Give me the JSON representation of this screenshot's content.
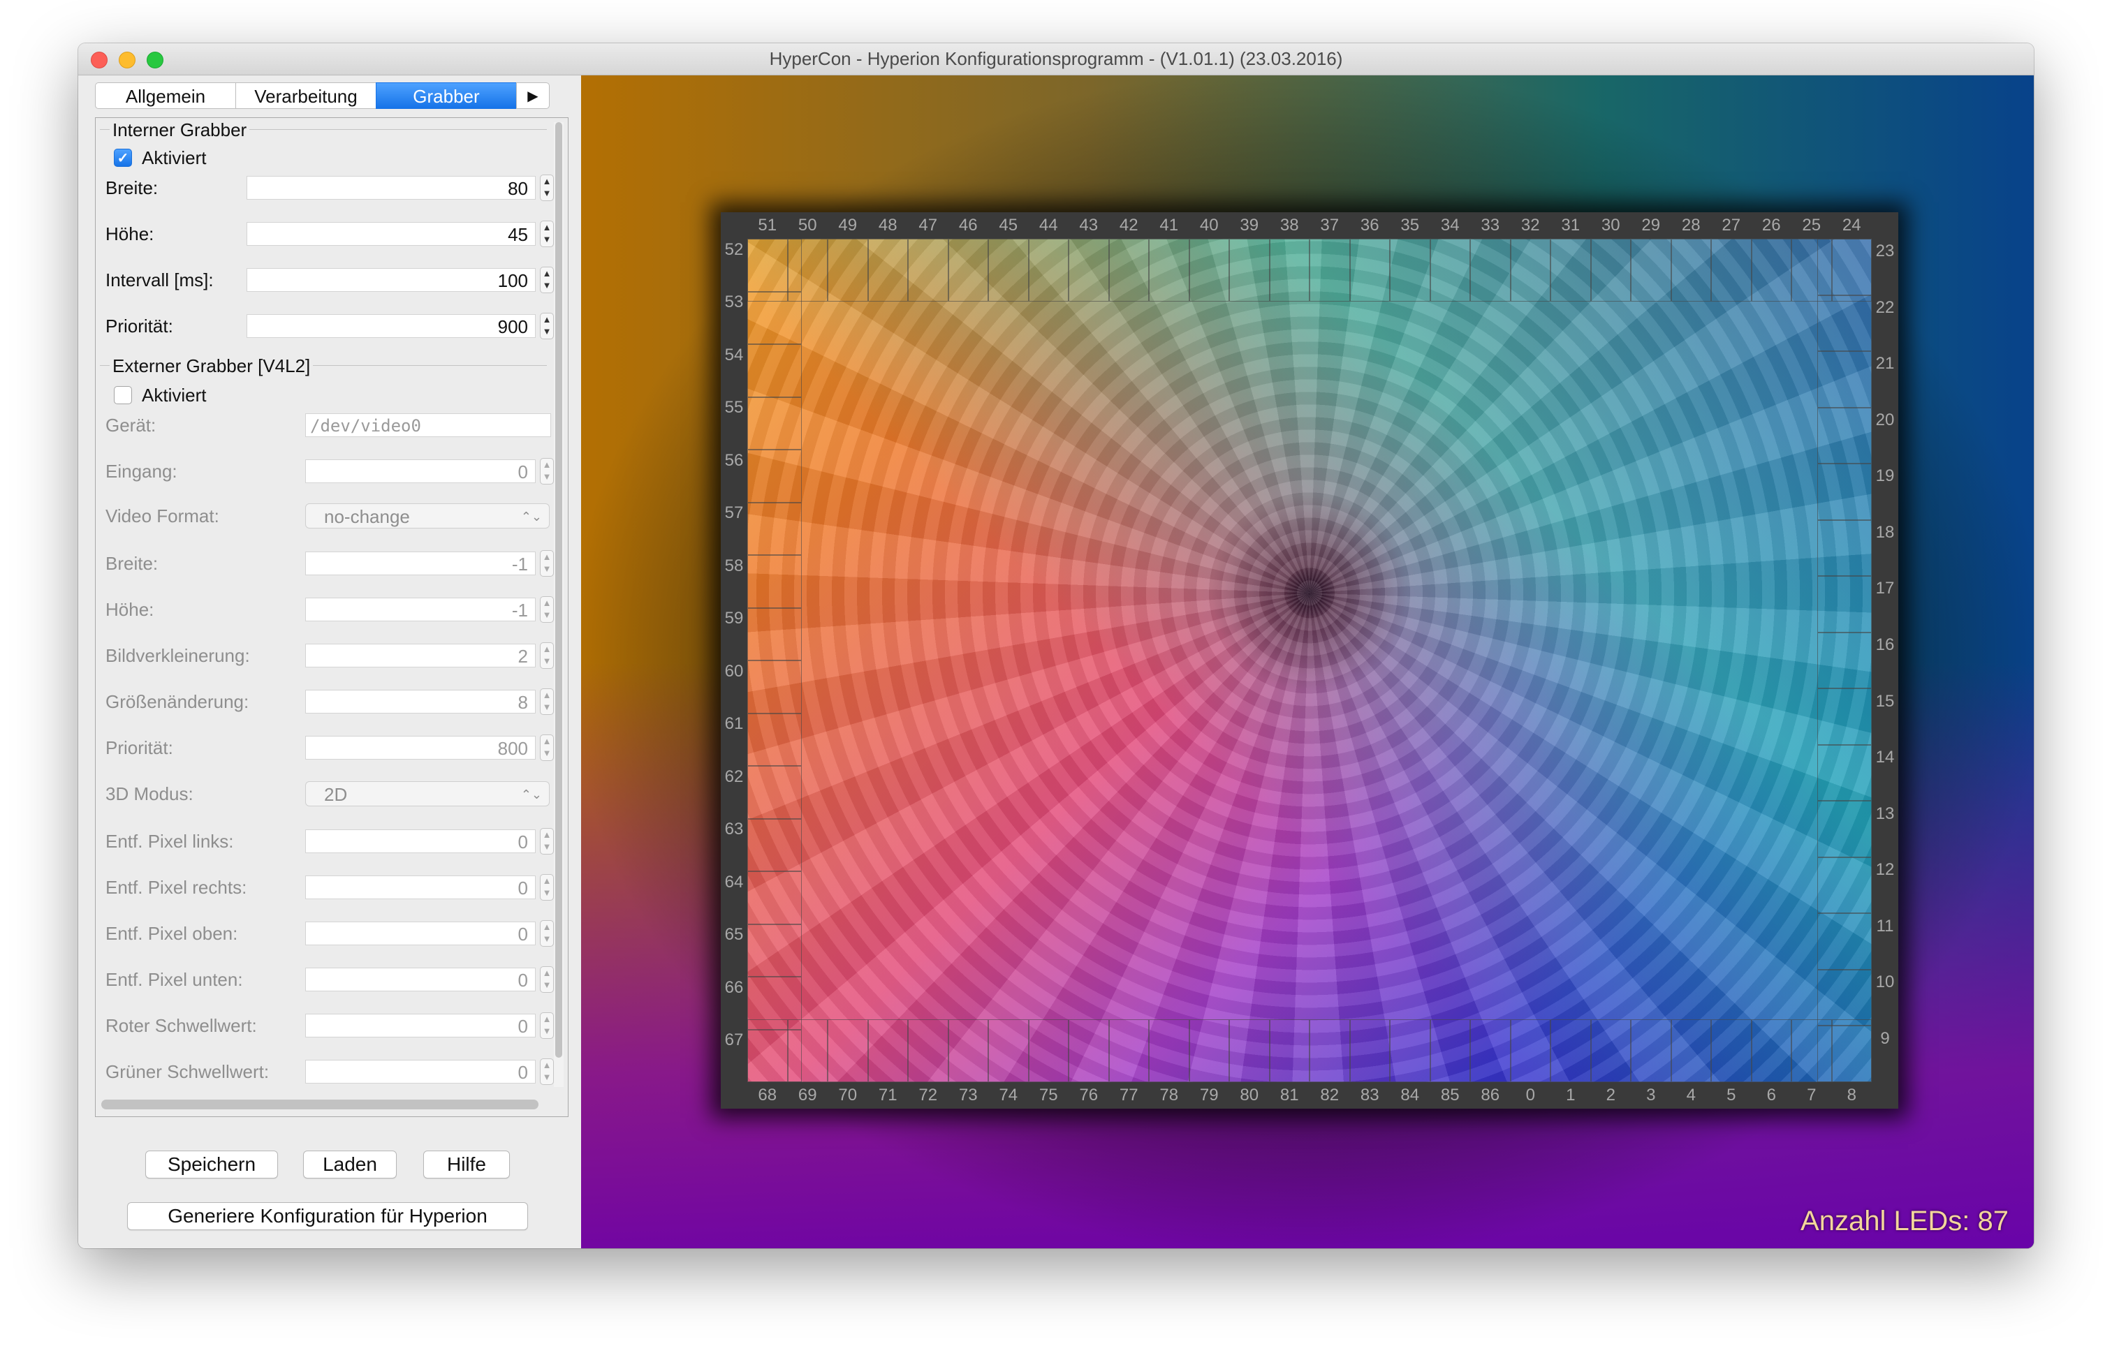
{
  "window": {
    "title": "HyperCon - Hyperion Konfigurationsprogramm - (V1.01.1) (23.03.2016)"
  },
  "tabs": [
    {
      "label": "Allgemein",
      "active": false
    },
    {
      "label": "Verarbeitung",
      "active": false
    },
    {
      "label": "Grabber",
      "active": true
    },
    {
      "label": "▶",
      "active": false
    }
  ],
  "internal": {
    "title": "Interner Grabber",
    "enabled_label": "Aktiviert",
    "enabled": true,
    "fields": [
      {
        "label": "Breite:",
        "value": "80"
      },
      {
        "label": "Höhe:",
        "value": "45"
      },
      {
        "label": "Intervall [ms]:",
        "value": "100"
      },
      {
        "label": "Priorität:",
        "value": "900"
      }
    ]
  },
  "external": {
    "title": "Externer Grabber [V4L2]",
    "enabled_label": "Aktiviert",
    "enabled": false,
    "device": {
      "label": "Gerät:",
      "value": "/dev/video0"
    },
    "input": {
      "label": "Eingang:",
      "value": "0"
    },
    "video_format": {
      "label": "Video Format:",
      "value": "no-change"
    },
    "width": {
      "label": "Breite:",
      "value": "-1"
    },
    "height": {
      "label": "Höhe:",
      "value": "-1"
    },
    "downscale": {
      "label": "Bildverkleinerung:",
      "value": "2"
    },
    "resize": {
      "label": "Größenänderung:",
      "value": "8"
    },
    "priority": {
      "label": "Priorität:",
      "value": "800"
    },
    "mode3d": {
      "label": "3D Modus:",
      "value": "2D"
    },
    "crop_left": {
      "label": "Entf. Pixel links:",
      "value": "0"
    },
    "crop_right": {
      "label": "Entf. Pixel rechts:",
      "value": "0"
    },
    "crop_top": {
      "label": "Entf. Pixel oben:",
      "value": "0"
    },
    "crop_bottom": {
      "label": "Entf. Pixel unten:",
      "value": "0"
    },
    "red_threshold": {
      "label": "Roter Schwellwert:",
      "value": "0"
    },
    "green_threshold": {
      "label": "Grüner Schwellwert:",
      "value": "0"
    }
  },
  "buttons": {
    "save": "Speichern",
    "load": "Laden",
    "help": "Hilfe",
    "generate": "Generiere Konfiguration für Hyperion"
  },
  "preview": {
    "led_count_text": "Anzahl LEDs: 87",
    "top_labels": [
      "51",
      "50",
      "49",
      "48",
      "47",
      "46",
      "45",
      "44",
      "43",
      "42",
      "41",
      "40",
      "39",
      "38",
      "37",
      "36",
      "35",
      "34",
      "33",
      "32",
      "31",
      "30",
      "29",
      "28",
      "27",
      "26",
      "25",
      "24"
    ],
    "bottom_labels": [
      "68",
      "69",
      "70",
      "71",
      "72",
      "73",
      "74",
      "75",
      "76",
      "77",
      "78",
      "79",
      "80",
      "81",
      "82",
      "83",
      "84",
      "85",
      "86",
      "0",
      "1",
      "2",
      "3",
      "4",
      "5",
      "6",
      "7",
      "8"
    ],
    "left_labels": [
      "52",
      "53",
      "54",
      "55",
      "56",
      "57",
      "58",
      "59",
      "60",
      "61",
      "62",
      "63",
      "64",
      "65",
      "66",
      "67"
    ],
    "right_labels": [
      "23",
      "22",
      "21",
      "20",
      "19",
      "18",
      "17",
      "16",
      "15",
      "14",
      "13",
      "12",
      "11",
      "10",
      "9"
    ]
  }
}
